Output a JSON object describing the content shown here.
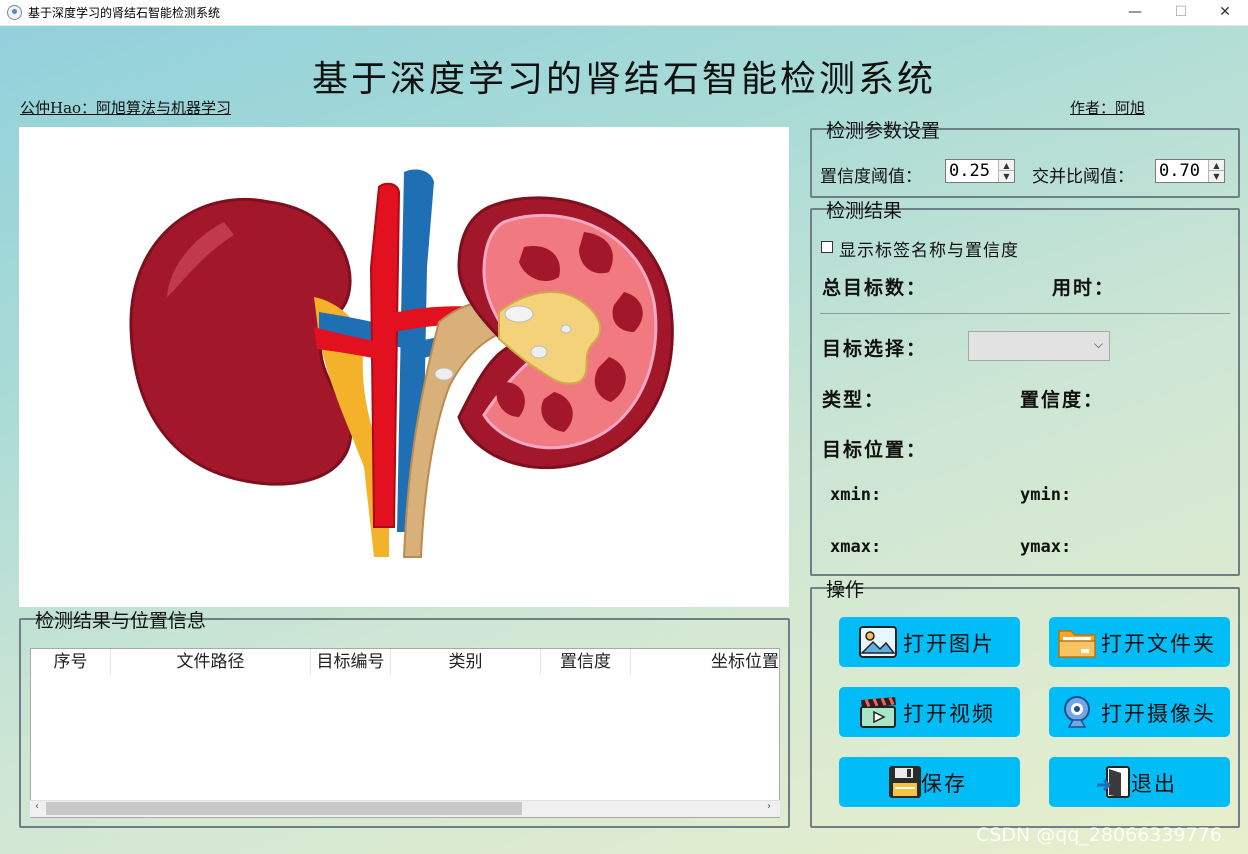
{
  "window": {
    "title": "基于深度学习的肾结石智能检测系统",
    "controls": {
      "minimize": "—",
      "maximize": "☐",
      "close": "✕"
    }
  },
  "header": {
    "title": "基于深度学习的肾结石智能检测系统",
    "wechat": "公仲Hao：阿旭算法与机器学习",
    "author": "作者：阿旭"
  },
  "table": {
    "title": "检测结果与位置信息",
    "columns": [
      "序号",
      "文件路径",
      "目标编号",
      "类别",
      "置信度",
      "坐标位置"
    ],
    "rows": [],
    "scroll_left": "‹",
    "scroll_right": "›"
  },
  "params": {
    "title": "检测参数设置",
    "confidence_label": "置信度阈值：",
    "confidence_value": "0.25",
    "iou_label": "交并比阈值：",
    "iou_value": "0.70"
  },
  "results": {
    "title": "检测结果",
    "show_labels": "显示标签名称与置信度",
    "total_targets": "总目标数：",
    "time_used": "用时：",
    "target_select": "目标选择：",
    "type": "类型：",
    "confidence": "置信度：",
    "position": "目标位置：",
    "xmin": "xmin:",
    "ymin": "ymin:",
    "xmax": "xmax:",
    "ymax": "ymax:",
    "selected_target": ""
  },
  "operations": {
    "title": "操作",
    "open_image": "打开图片",
    "open_folder": "打开文件夹",
    "open_video": "打开视频",
    "open_camera": "打开摄像头",
    "save": "保存",
    "exit": "退出"
  },
  "watermark": "CSDN @qq_28066339776",
  "colors": {
    "button": "#00bdf7",
    "kidney_red": "#a3172a",
    "artery_red": "#e3101f",
    "vein_blue": "#1f6fb5"
  }
}
